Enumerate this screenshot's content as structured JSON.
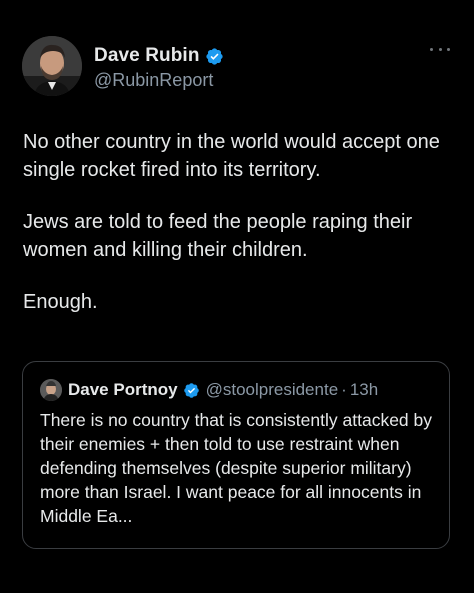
{
  "colors": {
    "background": "#000000",
    "text_primary": "#e7e9ea",
    "text_secondary": "#8b98a5",
    "verified_badge": "#1d9bf0",
    "quote_border": "#3a3d41"
  },
  "tweet": {
    "author": {
      "display_name": "Dave Rubin",
      "handle": "@RubinReport",
      "verified_icon": "verified-badge-icon",
      "avatar_icon": "profile-photo-avatar"
    },
    "more_icon": "more-options-icon",
    "paragraphs": [
      "No other country in the world would accept one single rocket fired into its territory.",
      "Jews are told to feed the people raping their women and killing their children.",
      "Enough."
    ],
    "quoted_tweet": {
      "display_name": "Dave Portnoy",
      "handle": "@stoolpresidente",
      "separator": "·",
      "time": "13h",
      "text": "There is no country that is consistently attacked by their enemies + then told to use restraint when defending themselves (despite superior military) more than Israel. I want peace for all innocents in Middle Ea..."
    }
  }
}
